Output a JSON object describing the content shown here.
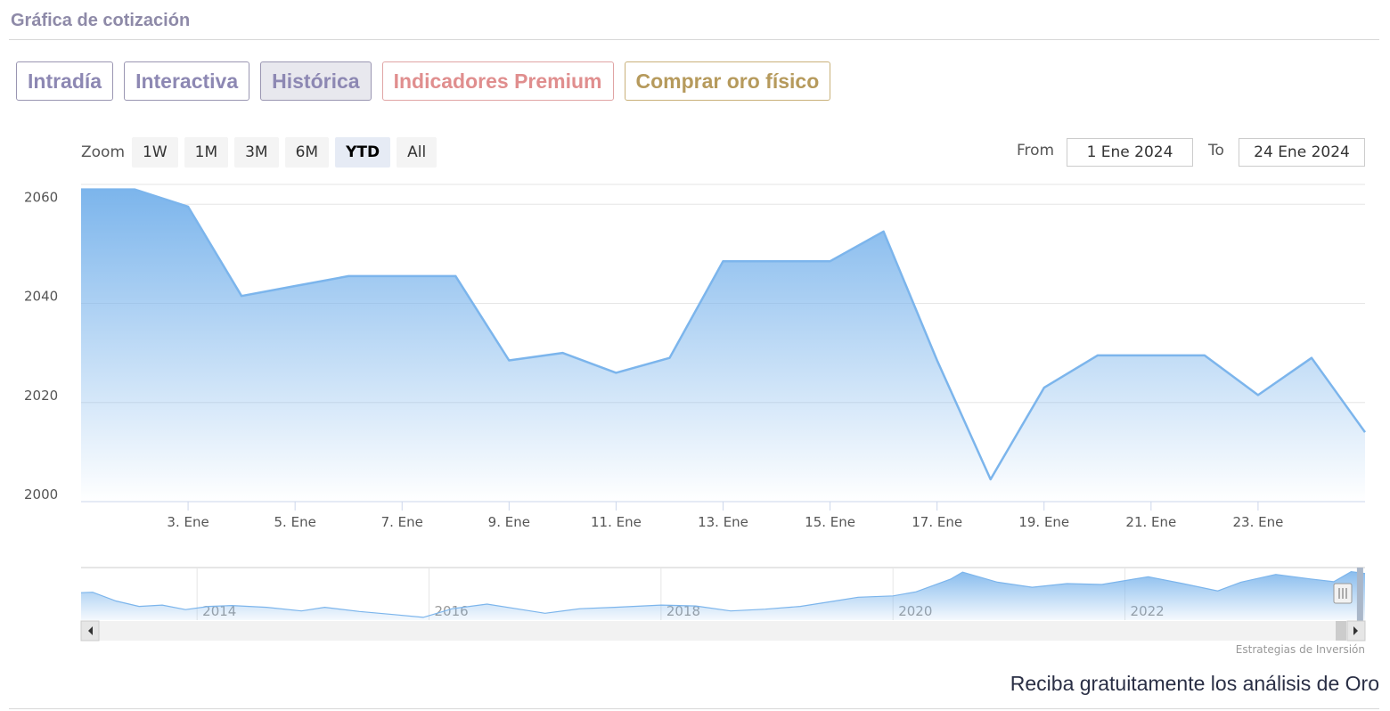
{
  "header": {
    "title": "Gráfica de cotización"
  },
  "tabs": [
    {
      "label": "Intradía"
    },
    {
      "label": "Interactiva"
    },
    {
      "label": "Histórica"
    },
    {
      "label": "Indicadores Premium"
    },
    {
      "label": "Comprar oro físico"
    }
  ],
  "zoom": {
    "label": "Zoom",
    "buttons": [
      "1W",
      "1M",
      "3M",
      "6M",
      "YTD",
      "All"
    ],
    "selected": "YTD"
  },
  "range": {
    "from_label": "From",
    "from_value": "1 Ene 2024",
    "to_label": "To",
    "to_value": "24 Ene 2024"
  },
  "colors": {
    "line": "#7cb5ec",
    "fill_top": "#7cb5ec",
    "accent": "#8d88b3"
  },
  "chart_data": {
    "type": "area",
    "title": "",
    "xlabel": "",
    "ylabel": "",
    "x": [
      1,
      2,
      3,
      4,
      5,
      6,
      7,
      8,
      9,
      10,
      11,
      12,
      13,
      14,
      15,
      16,
      17,
      18,
      19,
      20,
      21,
      22,
      23,
      24,
      25
    ],
    "values": [
      2063,
      2063,
      2059.5,
      2041.5,
      2043.5,
      2045.5,
      2045.5,
      2045.5,
      2028.5,
      2030,
      2026,
      2029,
      2048.5,
      2048.5,
      2048.5,
      2054.5,
      2028.5,
      2004.5,
      2023,
      2029.5,
      2029.5,
      2029.5,
      2021.5,
      2029,
      2014
    ],
    "ylim": [
      2000,
      2064
    ],
    "y_ticks": [
      "2000",
      "2020",
      "2040",
      "2060"
    ],
    "x_ticks": [
      {
        "x": 3,
        "label": "3. Ene"
      },
      {
        "x": 5,
        "label": "5. Ene"
      },
      {
        "x": 7,
        "label": "7. Ene"
      },
      {
        "x": 9,
        "label": "9. Ene"
      },
      {
        "x": 11,
        "label": "11. Ene"
      },
      {
        "x": 13,
        "label": "13. Ene"
      },
      {
        "x": 15,
        "label": "15. Ene"
      },
      {
        "x": 17,
        "label": "17. Ene"
      },
      {
        "x": 19,
        "label": "19. Ene"
      },
      {
        "x": 21,
        "label": "21. Ene"
      },
      {
        "x": 23,
        "label": "23. Ene"
      }
    ],
    "grid": true,
    "navigator": {
      "x_ticks": [
        {
          "year": 2014,
          "label": "2014"
        },
        {
          "year": 2016,
          "label": "2016"
        },
        {
          "year": 2018,
          "label": "2018"
        },
        {
          "year": 2020,
          "label": "2020"
        },
        {
          "year": 2022,
          "label": "2022"
        }
      ],
      "xlim": [
        2013,
        2024.07
      ],
      "series": [
        [
          2013.0,
          1600
        ],
        [
          2013.1,
          1610
        ],
        [
          2013.3,
          1420
        ],
        [
          2013.5,
          1300
        ],
        [
          2013.7,
          1330
        ],
        [
          2013.9,
          1230
        ],
        [
          2014.1,
          1300
        ],
        [
          2014.3,
          1320
        ],
        [
          2014.6,
          1280
        ],
        [
          2014.9,
          1200
        ],
        [
          2015.1,
          1280
        ],
        [
          2015.4,
          1190
        ],
        [
          2015.7,
          1120
        ],
        [
          2015.95,
          1060
        ],
        [
          2016.2,
          1250
        ],
        [
          2016.5,
          1350
        ],
        [
          2016.8,
          1230
        ],
        [
          2017.0,
          1150
        ],
        [
          2017.3,
          1250
        ],
        [
          2017.6,
          1280
        ],
        [
          2018.0,
          1330
        ],
        [
          2018.3,
          1310
        ],
        [
          2018.6,
          1200
        ],
        [
          2018.9,
          1240
        ],
        [
          2019.2,
          1300
        ],
        [
          2019.5,
          1420
        ],
        [
          2019.7,
          1500
        ],
        [
          2020.0,
          1530
        ],
        [
          2020.2,
          1620
        ],
        [
          2020.5,
          1900
        ],
        [
          2020.6,
          2050
        ],
        [
          2020.9,
          1830
        ],
        [
          2021.2,
          1720
        ],
        [
          2021.5,
          1800
        ],
        [
          2021.8,
          1780
        ],
        [
          2022.2,
          1950
        ],
        [
          2022.5,
          1800
        ],
        [
          2022.8,
          1640
        ],
        [
          2023.0,
          1830
        ],
        [
          2023.3,
          2000
        ],
        [
          2023.6,
          1900
        ],
        [
          2023.8,
          1840
        ],
        [
          2023.95,
          2060
        ],
        [
          2024.07,
          2020
        ]
      ],
      "ylim": [
        1000,
        2150
      ]
    },
    "credit": "Estrategias de Inversión"
  },
  "footer": {
    "subscribe_text": "Reciba gratuitamente los análisis de Oro"
  }
}
